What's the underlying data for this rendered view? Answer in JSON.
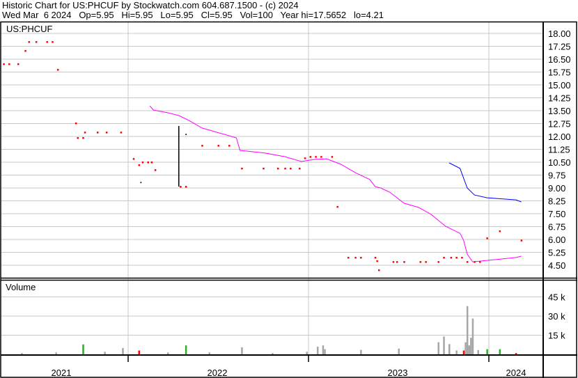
{
  "header": {
    "title": "Historic Chart for US:PHCUF by Stockwatch.com 604.687.1500 - (c) 2024",
    "quote": "Wed Mar  6 2024   Op=5.95   Hi=5.95   Lo=5.95   Cl=5.95   Vol=100   Year hi=17.5652   lo=4.21"
  },
  "colors": {
    "price": "#ff0000",
    "ma_long": "#ff00ff",
    "ma_short": "#0000ff",
    "vol_up": "#33aa33",
    "vol_down": "#ff0000",
    "vol_flat": "#a6a6a6",
    "grid": "#c8c8c8"
  },
  "chart_data": [
    {
      "type": "scatter",
      "title": "US:PHCUF",
      "x_unit": "decimal year",
      "ylim": [
        4.2,
        18.4
      ],
      "y_ticks": [
        "18.00",
        "17.25",
        "16.50",
        "15.75",
        "15.00",
        "14.25",
        "13.50",
        "12.75",
        "12.00",
        "11.25",
        "10.50",
        "9.75",
        "9.00",
        "8.25",
        "7.50",
        "6.75",
        "6.00",
        "5.25",
        "4.50"
      ],
      "x_ticks": [
        "2021",
        "2022",
        "2023",
        "2024"
      ],
      "grid": true,
      "price_points": [
        [
          2021.31,
          16.22
        ],
        [
          2021.34,
          16.22
        ],
        [
          2021.39,
          16.22
        ],
        [
          2021.43,
          16.99
        ],
        [
          2021.45,
          17.51
        ],
        [
          2021.49,
          17.51
        ],
        [
          2021.55,
          17.51
        ],
        [
          2021.58,
          17.51
        ],
        [
          2021.61,
          15.89
        ],
        [
          2021.71,
          12.77
        ],
        [
          2021.72,
          11.92
        ],
        [
          2021.75,
          11.92
        ],
        [
          2021.76,
          12.24
        ],
        [
          2021.83,
          12.24
        ],
        [
          2021.88,
          12.24
        ],
        [
          2021.96,
          12.24
        ],
        [
          2022.03,
          10.7
        ],
        [
          2022.06,
          10.34
        ],
        [
          2022.08,
          10.5
        ],
        [
          2022.11,
          10.5
        ],
        [
          2022.13,
          10.5
        ],
        [
          2022.15,
          10.05
        ],
        [
          2022.29,
          9.08
        ],
        [
          2022.32,
          9.08
        ],
        [
          2022.41,
          11.47
        ],
        [
          2022.5,
          11.47
        ],
        [
          2022.56,
          11.47
        ],
        [
          2022.63,
          10.14
        ],
        [
          2022.75,
          10.14
        ],
        [
          2022.83,
          10.14
        ],
        [
          2022.87,
          10.14
        ],
        [
          2022.9,
          10.14
        ],
        [
          2022.95,
          10.14
        ],
        [
          2022.98,
          10.74
        ],
        [
          2023.01,
          10.82
        ],
        [
          2023.04,
          10.82
        ],
        [
          2023.07,
          10.82
        ],
        [
          2023.13,
          10.82
        ],
        [
          2023.16,
          7.91
        ],
        [
          2023.22,
          4.95
        ],
        [
          2023.26,
          4.95
        ],
        [
          2023.29,
          4.95
        ],
        [
          2023.37,
          4.95
        ],
        [
          2023.38,
          4.75
        ],
        [
          2023.39,
          4.22
        ],
        [
          2023.47,
          4.7
        ],
        [
          2023.49,
          4.7
        ],
        [
          2023.53,
          4.7
        ],
        [
          2023.62,
          4.7
        ],
        [
          2023.65,
          4.7
        ],
        [
          2023.72,
          4.7
        ],
        [
          2023.75,
          4.95
        ],
        [
          2023.79,
          4.95
        ],
        [
          2023.82,
          4.95
        ],
        [
          2023.85,
          4.95
        ],
        [
          2023.88,
          4.7
        ],
        [
          2023.92,
          4.7
        ],
        [
          2023.95,
          4.7
        ],
        [
          2023.99,
          6.08
        ],
        [
          2024.06,
          6.49
        ],
        [
          2024.18,
          5.95
        ]
      ],
      "black_ticks": [
        [
          2022.07,
          9.32,
          9.32
        ],
        [
          2022.28,
          9.08,
          12.57
        ],
        [
          2022.32,
          12.12,
          12.12
        ]
      ],
      "series": [
        {
          "name": "long moving average",
          "color": "#ff00ff",
          "points": [
            [
              2022.12,
              13.78
            ],
            [
              2022.14,
              13.54
            ],
            [
              2022.22,
              13.38
            ],
            [
              2022.28,
              13.22
            ],
            [
              2022.33,
              12.97
            ],
            [
              2022.41,
              12.49
            ],
            [
              2022.6,
              11.92
            ],
            [
              2022.62,
              11.19
            ],
            [
              2022.76,
              11.03
            ],
            [
              2022.87,
              10.82
            ],
            [
              2022.96,
              10.54
            ],
            [
              2023.03,
              10.66
            ],
            [
              2023.1,
              10.7
            ],
            [
              2023.18,
              10.38
            ],
            [
              2023.26,
              9.89
            ],
            [
              2023.34,
              9.49
            ],
            [
              2023.37,
              9.08
            ],
            [
              2023.4,
              9.0
            ],
            [
              2023.45,
              8.76
            ],
            [
              2023.53,
              8.11
            ],
            [
              2023.61,
              7.87
            ],
            [
              2023.68,
              7.46
            ],
            [
              2023.76,
              6.77
            ],
            [
              2023.84,
              6.36
            ],
            [
              2023.86,
              5.96
            ],
            [
              2023.88,
              5.15
            ],
            [
              2023.91,
              4.7
            ],
            [
              2023.99,
              4.78
            ],
            [
              2024.15,
              4.95
            ],
            [
              2024.18,
              5.03
            ]
          ]
        },
        {
          "name": "short moving average",
          "color": "#0000ff",
          "points": [
            [
              2023.78,
              10.46
            ],
            [
              2023.84,
              10.14
            ],
            [
              2023.88,
              9.0
            ],
            [
              2023.92,
              8.59
            ],
            [
              2023.99,
              8.43
            ],
            [
              2024.15,
              8.31
            ],
            [
              2024.18,
              8.19
            ]
          ]
        }
      ]
    },
    {
      "type": "bar",
      "title": "Volume",
      "ylim": [
        0,
        52000
      ],
      "y_ticks": [
        "45 k",
        "30 k",
        "15 k"
      ],
      "bars": [
        [
          2021.41,
          1000,
          "flat"
        ],
        [
          2021.6,
          1500,
          "flat"
        ],
        [
          2021.75,
          7800,
          "up"
        ],
        [
          2021.87,
          2000,
          "flat"
        ],
        [
          2021.97,
          5000,
          "flat"
        ],
        [
          2022.06,
          3000,
          "down"
        ],
        [
          2022.22,
          1500,
          "flat"
        ],
        [
          2022.32,
          7000,
          "up"
        ],
        [
          2022.45,
          1500,
          "flat"
        ],
        [
          2022.63,
          5500,
          "flat"
        ],
        [
          2022.8,
          1000,
          "flat"
        ],
        [
          2022.99,
          2000,
          "flat"
        ],
        [
          2023.05,
          6000,
          "flat"
        ],
        [
          2023.08,
          7000,
          "flat"
        ],
        [
          2023.09,
          4000,
          "flat"
        ],
        [
          2023.29,
          3500,
          "flat"
        ],
        [
          2023.5,
          4500,
          "flat"
        ],
        [
          2023.72,
          9500,
          "flat"
        ],
        [
          2023.75,
          14000,
          "flat"
        ],
        [
          2023.78,
          8000,
          "flat"
        ],
        [
          2023.82,
          3000,
          "flat"
        ],
        [
          2023.86,
          3000,
          "down"
        ],
        [
          2023.87,
          9500,
          "flat"
        ],
        [
          2023.88,
          37800,
          "flat"
        ],
        [
          2023.89,
          7000,
          "flat"
        ],
        [
          2023.9,
          13000,
          "flat"
        ],
        [
          2023.91,
          28000,
          "flat"
        ],
        [
          2023.94,
          3300,
          "flat"
        ],
        [
          2023.99,
          4000,
          "up"
        ],
        [
          2024.06,
          4000,
          "up"
        ],
        [
          2024.15,
          1000,
          "down"
        ]
      ]
    }
  ]
}
